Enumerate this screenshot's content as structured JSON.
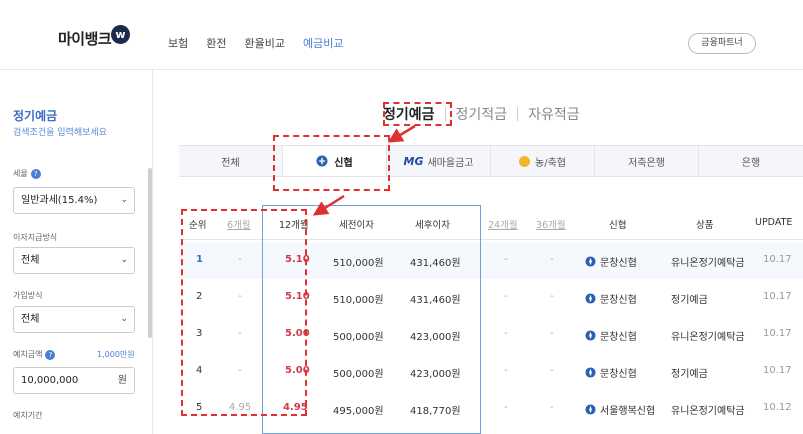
{
  "header": {
    "logo_text": "마이뱅크",
    "logo_badge": "w",
    "nav": [
      "보험",
      "환전",
      "환율비교",
      "예금비교"
    ],
    "active_nav": 3,
    "partner_button": "금융파트너"
  },
  "sidebar": {
    "title": "정기예금",
    "subtitle": "검색조건을 입력해보세요",
    "tax_label": "세율",
    "tax_value": "일반과세(15.4%)",
    "interest_label": "이자지급방식",
    "interest_value": "전체",
    "join_label": "가입방식",
    "join_value": "전체",
    "amount_label": "예치금액",
    "amount_hint": "1,000만원",
    "amount_value": "10,000,000",
    "amount_unit": "원",
    "period_label": "예치기간"
  },
  "main_tabs": [
    "정기예금",
    "정기적금",
    "자유적금"
  ],
  "bank_tabs": [
    "전체",
    "신협",
    "새마을금고",
    "농/축협",
    "저축은행",
    "은행"
  ],
  "colors": {
    "accent_blue": "#4a7fd6",
    "rate_red": "#d33a4a",
    "annotation_red": "#e03030"
  },
  "table": {
    "headers": {
      "rank": "순위",
      "m6": "6개월",
      "m12": "12개월",
      "pretax": "세전이자",
      "aftertax": "세후이자",
      "m24": "24개월",
      "m36": "36개월",
      "bank": "신협",
      "product": "상품",
      "update": "UPDATE"
    },
    "rows": [
      {
        "rank": "1",
        "m6": "-",
        "m12": "5.10",
        "pretax": "510,000원",
        "aftertax": "431,460원",
        "m24": "-",
        "m36": "-",
        "bank": "문창신협",
        "product": "유니온정기예탁금",
        "update": "10.17"
      },
      {
        "rank": "2",
        "m6": "-",
        "m12": "5.10",
        "pretax": "510,000원",
        "aftertax": "431,460원",
        "m24": "-",
        "m36": "-",
        "bank": "문창신협",
        "product": "정기예금",
        "update": "10.17"
      },
      {
        "rank": "3",
        "m6": "-",
        "m12": "5.00",
        "pretax": "500,000원",
        "aftertax": "423,000원",
        "m24": "-",
        "m36": "-",
        "bank": "문창신협",
        "product": "유니온정기예탁금",
        "update": "10.17"
      },
      {
        "rank": "4",
        "m6": "-",
        "m12": "5.00",
        "pretax": "500,000원",
        "aftertax": "423,000원",
        "m24": "-",
        "m36": "-",
        "bank": "문창신협",
        "product": "정기예금",
        "update": "10.17"
      },
      {
        "rank": "5",
        "m6": "4.95",
        "m12": "4.95",
        "pretax": "495,000원",
        "aftertax": "418,770원",
        "m24": "-",
        "m36": "-",
        "bank": "서울행복신협",
        "product": "유니온정기예탁금",
        "update": "10.12"
      }
    ]
  }
}
